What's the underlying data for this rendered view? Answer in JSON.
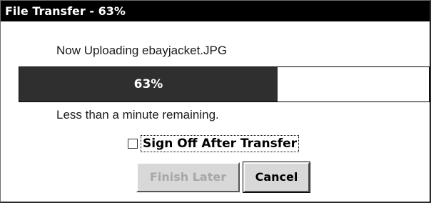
{
  "window": {
    "title": "File Transfer - 63%"
  },
  "transfer": {
    "status_text": "Now Uploading ebayjacket.JPG",
    "progress_percent": 63,
    "progress_label": "63%",
    "time_remaining": "Less than a minute remaining."
  },
  "options": {
    "sign_off_label": "Sign Off After Transfer",
    "sign_off_checked": false
  },
  "buttons": {
    "finish_later": "Finish Later",
    "finish_later_enabled": false,
    "cancel": "Cancel"
  },
  "colors": {
    "titlebar": "#000000",
    "progress_fill": "#2f2f2f",
    "button_face": "#d8d8d8",
    "disabled_text": "#a7a7a7"
  }
}
